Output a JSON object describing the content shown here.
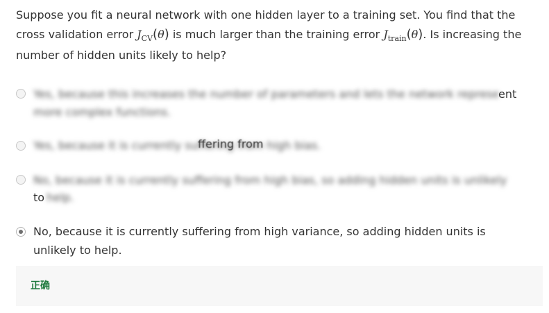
{
  "question": {
    "part1": "Suppose you fit a neural network with one hidden layer to a training set. You find that the cross validation error ",
    "jcv_symbol": "J",
    "jcv_sub": "CV",
    "theta1": "θ",
    "part2": " is much larger than the training error ",
    "jtrain_symbol": "J",
    "jtrain_sub": "train",
    "theta2": "θ",
    "part3": ". Is increasing the number of hidden units likely to help?"
  },
  "options": [
    {
      "blurred_line1": "Yes, because this increases the number of parameters and lets the network represent",
      "visible_tail": "ent",
      "blurred_line2": "more complex functions.",
      "selected": false
    },
    {
      "blurred_line1": "Yes, because it is currently suffering from high bias.",
      "visible_fragment": "ffering from",
      "selected": false
    },
    {
      "blurred_line1": "No, because it is currently suffering from high bias, so adding hidden units is unlikely",
      "visible_head": "to",
      "blurred_line2": " help.",
      "selected": false
    },
    {
      "text": "No, because it is currently suffering from high variance, so adding hidden units is unlikely to help.",
      "selected": true
    }
  ],
  "feedback": {
    "label": "正确",
    "color": "#1f7a3e"
  }
}
